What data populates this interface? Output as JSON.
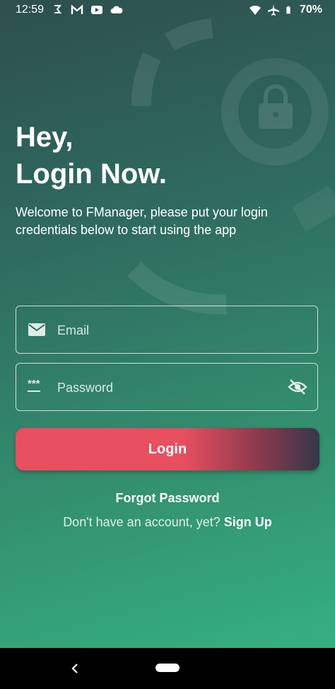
{
  "status_bar": {
    "time": "12:59",
    "left_icons": [
      "notification-icon",
      "gmail-icon",
      "youtube-icon",
      "cloud-icon"
    ],
    "right_icons": [
      "wifi-icon",
      "airplane-icon",
      "battery-icon"
    ],
    "battery": "70%"
  },
  "hero": {
    "title": "Hey,\nLogin Now.",
    "subtitle": "Welcome to FManager, please put your login credentials below to start using the app"
  },
  "form": {
    "email_placeholder": "Email",
    "email_value": "",
    "password_placeholder": "Password",
    "password_value": "",
    "password_prefix_text": "***",
    "login_label": "Login"
  },
  "links": {
    "forgot": "Forgot Password",
    "no_account": "Don't have an account, yet?",
    "signup": "Sign Up"
  },
  "colors": {
    "accent": "#e84f5f",
    "bg_top": "#2d4f4d",
    "bg_bottom": "#35b081"
  }
}
